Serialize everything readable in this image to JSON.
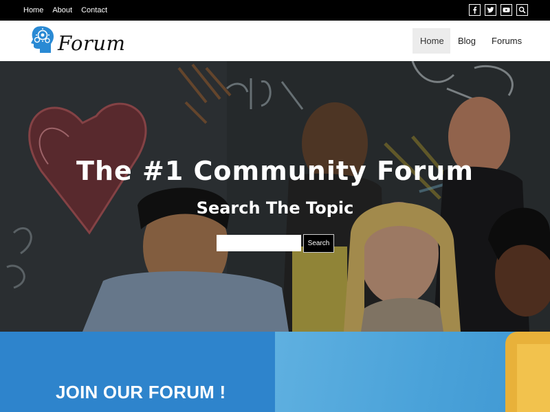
{
  "topbar": {
    "links": [
      "Home",
      "About",
      "Contact"
    ],
    "social_icons": [
      "facebook-icon",
      "twitter-icon",
      "youtube-icon",
      "search-icon"
    ]
  },
  "header": {
    "logo_text": "Forum",
    "nav": [
      "Home",
      "Blog",
      "Forums"
    ],
    "active_nav": "Home"
  },
  "hero": {
    "title": "The #1 Community Forum",
    "subtitle": "Search The Topic",
    "search_value": "",
    "search_button": "Search"
  },
  "join": {
    "title": "JOIN OUR FORUM !"
  },
  "colors": {
    "topbar_bg": "#000000",
    "accent_blue": "#2e84cc",
    "logo_blue": "#2a8ad4",
    "nav_active_bg": "#ececec"
  }
}
